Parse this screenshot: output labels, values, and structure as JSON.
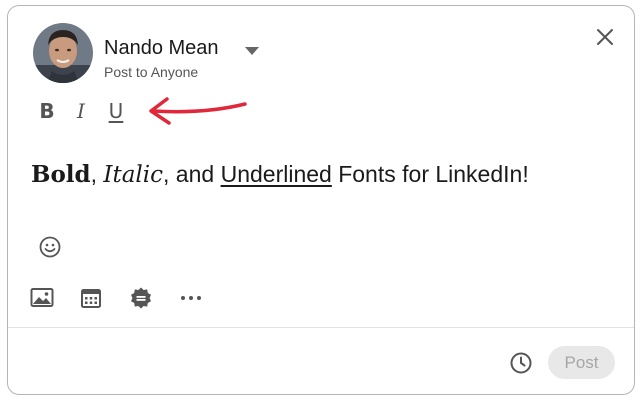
{
  "author": {
    "name": "Nando Mean",
    "visibility": "Post to Anyone"
  },
  "formatting": {
    "bold": "B",
    "italic": "I",
    "underline": "U"
  },
  "post": {
    "bold_word": "Bold",
    "sep1": ", ",
    "italic_word": "Italic",
    "sep2": ", and ",
    "underline_word": "Underlined",
    "rest": " Fonts for LinkedIn!"
  },
  "footer": {
    "post_label": "Post"
  },
  "icons": {
    "close": "close-icon",
    "caret": "caret-down-icon",
    "emoji": "smiley-icon",
    "photo": "image-icon",
    "event": "calendar-icon",
    "badge": "badge-icon",
    "more": "more-icon",
    "schedule": "clock-icon",
    "annotation": "red-arrow-icon"
  },
  "colors": {
    "annotation": "#e0283a",
    "icon": "#555555",
    "post_button_bg": "#e8e8e8",
    "post_button_text": "#a6a6a6"
  }
}
